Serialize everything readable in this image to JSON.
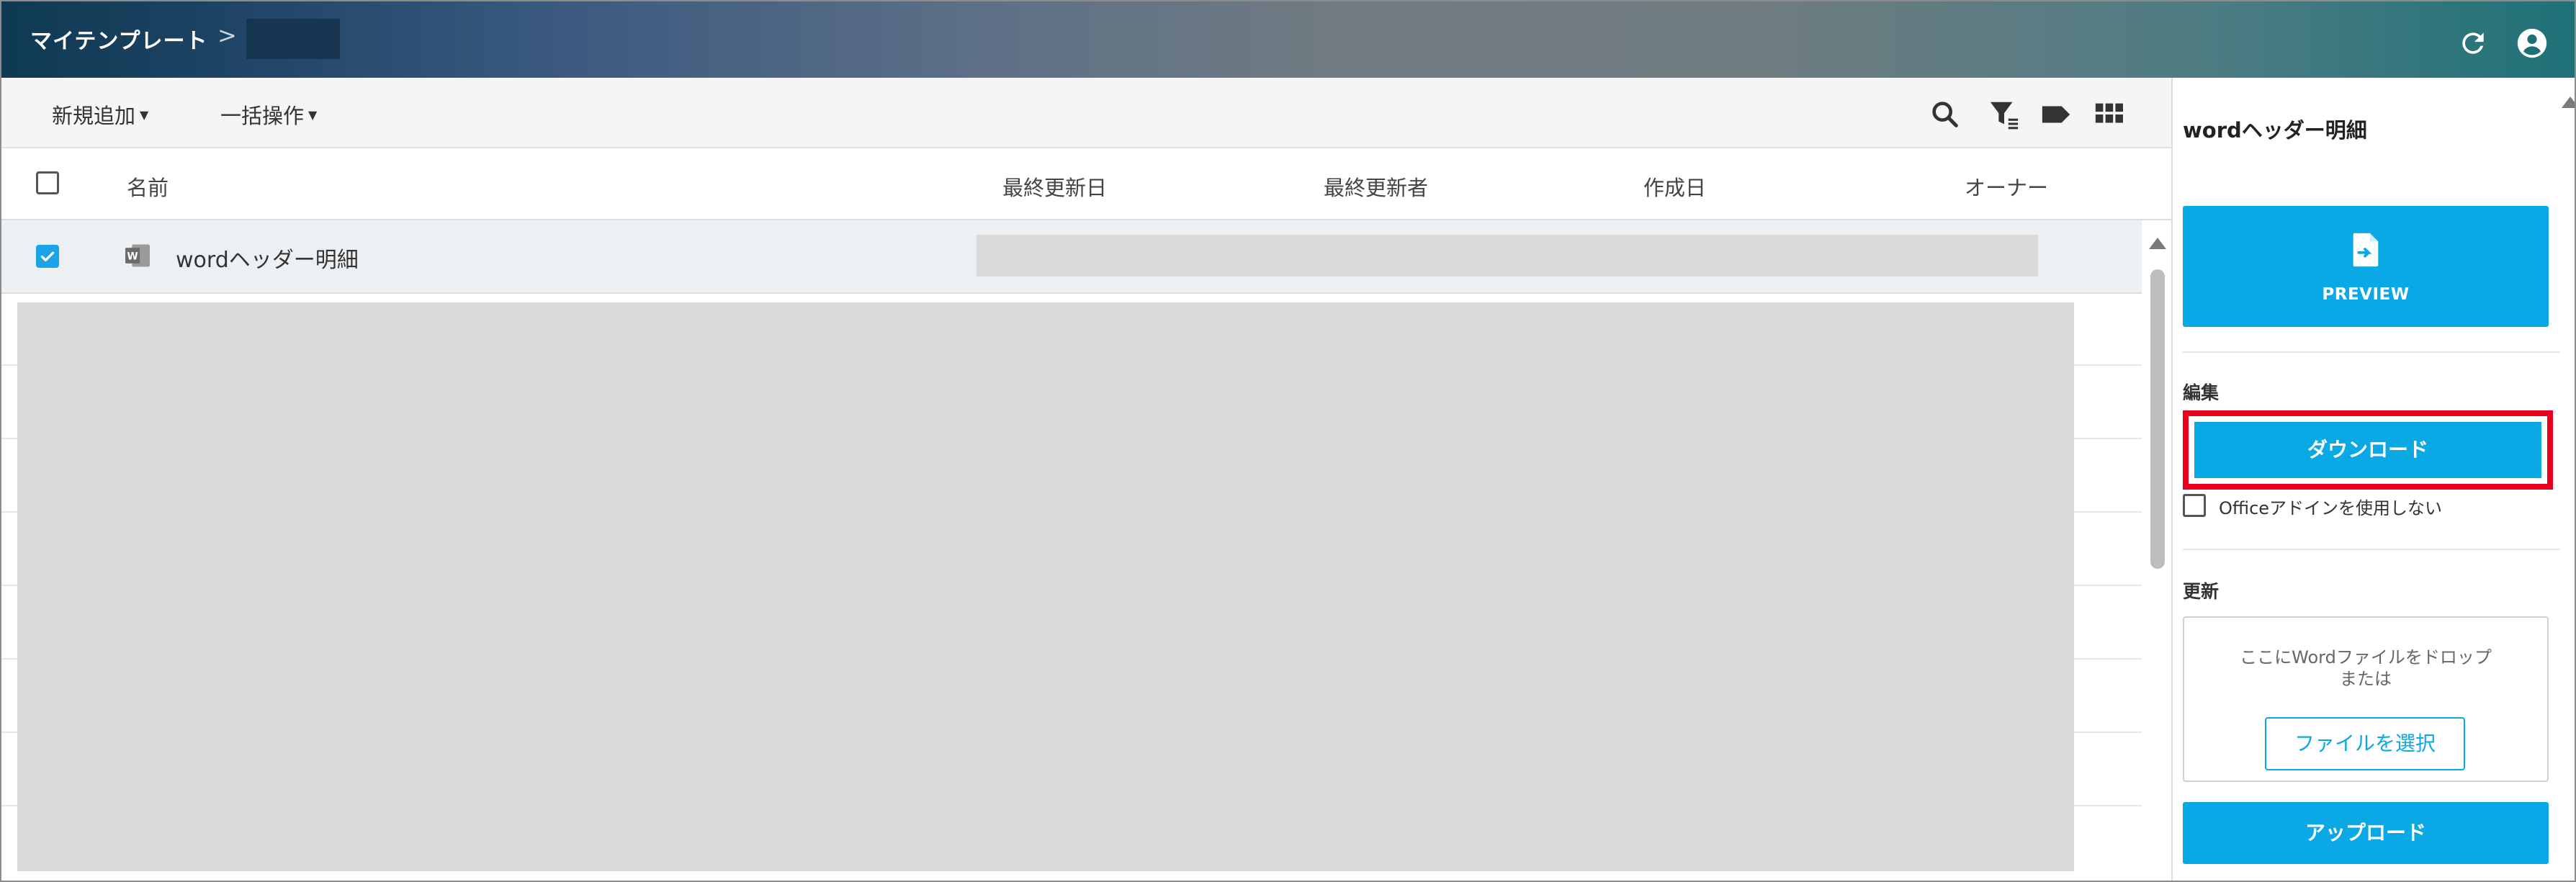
{
  "header": {
    "breadcrumb_title": "マイテンプレート",
    "breadcrumb_separator": ">",
    "icons": [
      "refresh-icon",
      "user-account-icon"
    ]
  },
  "toolbar": {
    "new_label": "新規追加",
    "bulk_label": "一括操作",
    "icons": [
      "search-icon",
      "filter-icon",
      "tag-icon",
      "grid-view-icon"
    ]
  },
  "table": {
    "columns": [
      "名前",
      "最終更新日",
      "最終更新者",
      "作成日",
      "オーナー"
    ],
    "rows": [
      {
        "name": "wordヘッダー明細",
        "selected": true,
        "icon": "word-file-icon"
      }
    ]
  },
  "panel": {
    "title": "wordヘッダー明細",
    "preview_label": "PREVIEW",
    "edit_section": "編集",
    "download_label": "ダウンロード",
    "addin_label": "Officeアドインを使用しない",
    "update_section": "更新",
    "drop_text_line1": "ここにWordファイルをドロップ",
    "drop_text_line2": "または",
    "file_select_label": "ファイルを選択",
    "upload_label": "アップロード"
  },
  "colors": {
    "accent": "#0aa9e6",
    "highlight": "#e8001e",
    "checkbox_on": "#1aa3e6"
  }
}
